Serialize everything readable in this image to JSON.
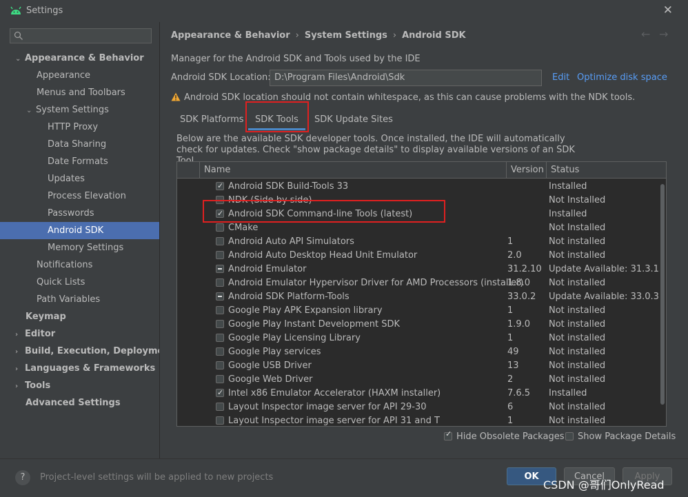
{
  "window": {
    "title": "Settings"
  },
  "sidebar": {
    "search_placeholder": "",
    "items": [
      {
        "label": "Appearance & Behavior"
      },
      {
        "label": "Appearance"
      },
      {
        "label": "Menus and Toolbars"
      },
      {
        "label": "System Settings"
      },
      {
        "label": "HTTP Proxy"
      },
      {
        "label": "Data Sharing"
      },
      {
        "label": "Date Formats"
      },
      {
        "label": "Updates"
      },
      {
        "label": "Process Elevation"
      },
      {
        "label": "Passwords"
      },
      {
        "label": "Android SDK"
      },
      {
        "label": "Memory Settings"
      },
      {
        "label": "Notifications"
      },
      {
        "label": "Quick Lists"
      },
      {
        "label": "Path Variables"
      },
      {
        "label": "Keymap"
      },
      {
        "label": "Editor"
      },
      {
        "label": "Build, Execution, Deployment"
      },
      {
        "label": "Languages & Frameworks"
      },
      {
        "label": "Tools"
      },
      {
        "label": "Advanced Settings"
      }
    ]
  },
  "breadcrumb": [
    "Appearance & Behavior",
    "System Settings",
    "Android SDK"
  ],
  "main": {
    "description": "Manager for the Android SDK and Tools used by the IDE",
    "sdk_location_label": "Android SDK Location:",
    "sdk_location_value": "D:\\Program Files\\Android\\Sdk",
    "edit_link": "Edit",
    "optimize_link": "Optimize disk space",
    "warning": "Android SDK location should not contain whitespace, as this can cause problems with the NDK tools.",
    "tabs": [
      {
        "label": "SDK Platforms"
      },
      {
        "label": "SDK Tools"
      },
      {
        "label": "SDK Update Sites"
      }
    ],
    "tools_description": "Below are the available SDK developer tools. Once installed, the IDE will automatically check for updates. Check \"show package details\" to display available versions of an SDK Tool.",
    "table": {
      "columns": [
        "Name",
        "Version",
        "Status"
      ],
      "rows": [
        {
          "name": "Android SDK Build-Tools 33",
          "version": "",
          "status": "Installed",
          "check": "checked"
        },
        {
          "name": "NDK (Side by side)",
          "version": "",
          "status": "Not Installed",
          "check": "unchecked"
        },
        {
          "name": "Android SDK Command-line Tools (latest)",
          "version": "",
          "status": "Installed",
          "check": "checked"
        },
        {
          "name": "CMake",
          "version": "",
          "status": "Not Installed",
          "check": "unchecked"
        },
        {
          "name": "Android Auto API Simulators",
          "version": "1",
          "status": "Not installed",
          "check": "unchecked"
        },
        {
          "name": "Android Auto Desktop Head Unit Emulator",
          "version": "2.0",
          "status": "Not installed",
          "check": "unchecked"
        },
        {
          "name": "Android Emulator",
          "version": "31.2.10",
          "status": "Update Available: 31.3.13",
          "check": "partial"
        },
        {
          "name": "Android Emulator Hypervisor Driver for AMD Processors (installer)",
          "version": "1.8.0",
          "status": "Not installed",
          "check": "unchecked"
        },
        {
          "name": "Android SDK Platform-Tools",
          "version": "33.0.2",
          "status": "Update Available: 33.0.3",
          "check": "partial"
        },
        {
          "name": "Google Play APK Expansion library",
          "version": "1",
          "status": "Not installed",
          "check": "unchecked"
        },
        {
          "name": "Google Play Instant Development SDK",
          "version": "1.9.0",
          "status": "Not installed",
          "check": "unchecked"
        },
        {
          "name": "Google Play Licensing Library",
          "version": "1",
          "status": "Not installed",
          "check": "unchecked"
        },
        {
          "name": "Google Play services",
          "version": "49",
          "status": "Not installed",
          "check": "unchecked"
        },
        {
          "name": "Google USB Driver",
          "version": "13",
          "status": "Not installed",
          "check": "unchecked"
        },
        {
          "name": "Google Web Driver",
          "version": "2",
          "status": "Not installed",
          "check": "unchecked"
        },
        {
          "name": "Intel x86 Emulator Accelerator (HAXM installer)",
          "version": "7.6.5",
          "status": "Installed",
          "check": "checked"
        },
        {
          "name": "Layout Inspector image server for API 29-30",
          "version": "6",
          "status": "Not installed",
          "check": "unchecked"
        },
        {
          "name": "Layout Inspector image server for API 31 and T",
          "version": "1",
          "status": "Not installed",
          "check": "unchecked"
        }
      ]
    },
    "hide_obsolete_label": "Hide Obsolete Packages",
    "show_details_label": "Show Package Details"
  },
  "footer": {
    "help": "?",
    "hint": "Project-level settings will be applied to new projects",
    "ok": "OK",
    "cancel": "Cancel",
    "apply": "Apply"
  },
  "watermark": "CSDN @哥们OnlyRead",
  "colors": {
    "accent": "#4b6eaf",
    "link": "#589df6",
    "highlight": "#e02020",
    "background": "#3c3f41"
  }
}
